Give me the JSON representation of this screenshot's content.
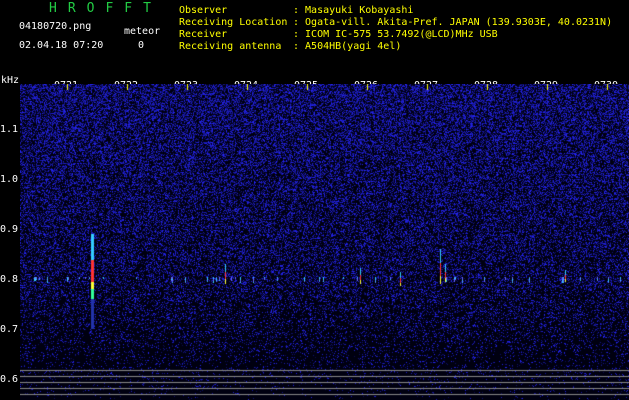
{
  "header": {
    "logo": "HROFFT",
    "filename": "04180720.png",
    "datetime": "02.04.18 07:20",
    "meteor_label": "meteor",
    "meteor_count": "0",
    "info": [
      {
        "label": "Observer",
        "value": ": Masayuki Kobayashi"
      },
      {
        "label": "Receiving Location",
        "value": ": Ogata-vill. Akita-Pref. JAPAN (139.9303E, 40.0231N)"
      },
      {
        "label": "Receiver",
        "value": ": ICOM IC-575 53.7492(@LCD)MHz USB"
      },
      {
        "label": "Receiving antenna",
        "value": ": A504HB(yagi 4el)"
      }
    ]
  },
  "axes": {
    "y_unit": "kHz",
    "y_ticks": [
      "1.1",
      "1.0",
      "0.9",
      "0.8",
      "0.7",
      "0.6"
    ],
    "x_ticks": [
      "0721",
      "0722",
      "0723",
      "0724",
      "0725",
      "0726",
      "0727",
      "0728",
      "0729",
      "0730"
    ]
  },
  "colors": {
    "noise": "#1a1aa0",
    "signal_low": "#33ccff",
    "signal_mid": "#ffff33",
    "signal_high": "#ff3333",
    "tick": "#ffff00",
    "label": "#ffffff"
  }
}
